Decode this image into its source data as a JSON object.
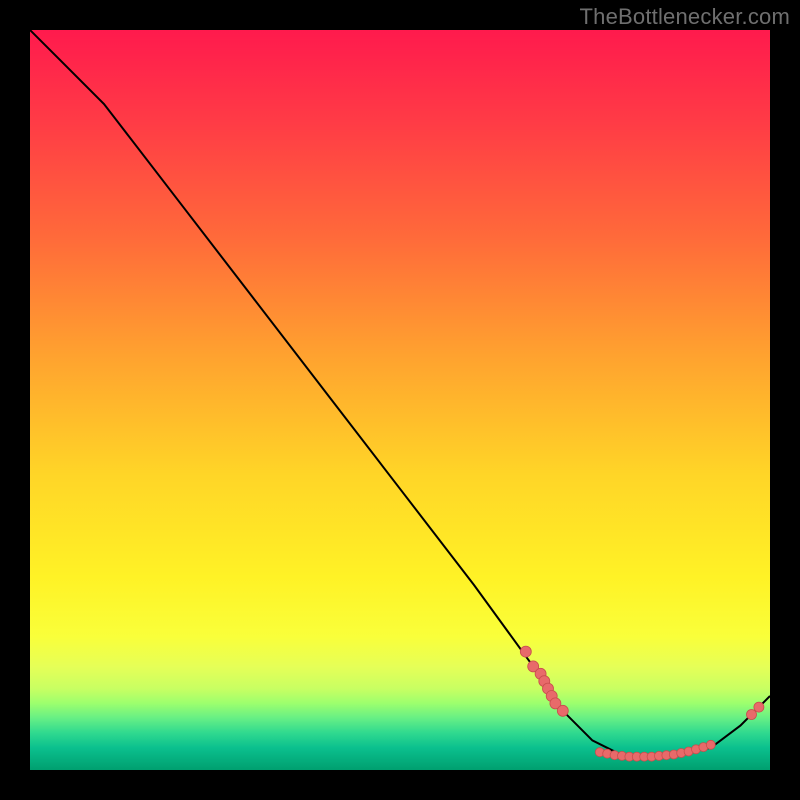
{
  "watermark": "TheBottlenecker.com",
  "chart_data": {
    "type": "line",
    "title": "",
    "xlabel": "",
    "ylabel": "",
    "xlim": [
      0,
      100
    ],
    "ylim": [
      0,
      100
    ],
    "grid": false,
    "legend": false,
    "curve_points": [
      {
        "x": 0,
        "y": 100
      },
      {
        "x": 4,
        "y": 96
      },
      {
        "x": 10,
        "y": 90
      },
      {
        "x": 20,
        "y": 77
      },
      {
        "x": 30,
        "y": 64
      },
      {
        "x": 40,
        "y": 51
      },
      {
        "x": 50,
        "y": 38
      },
      {
        "x": 60,
        "y": 25
      },
      {
        "x": 68,
        "y": 14
      },
      {
        "x": 72,
        "y": 8
      },
      {
        "x": 76,
        "y": 4
      },
      {
        "x": 80,
        "y": 2
      },
      {
        "x": 86,
        "y": 2
      },
      {
        "x": 92,
        "y": 3
      },
      {
        "x": 96,
        "y": 6
      },
      {
        "x": 100,
        "y": 10
      }
    ],
    "markers_left": [
      {
        "x": 67,
        "y": 16
      },
      {
        "x": 68,
        "y": 14
      },
      {
        "x": 69,
        "y": 13
      },
      {
        "x": 69.5,
        "y": 12
      },
      {
        "x": 70,
        "y": 11
      },
      {
        "x": 70.5,
        "y": 10
      },
      {
        "x": 71,
        "y": 9
      },
      {
        "x": 72,
        "y": 8
      }
    ],
    "markers_bottom": [
      {
        "x": 77,
        "y": 2.4
      },
      {
        "x": 78,
        "y": 2.2
      },
      {
        "x": 79,
        "y": 2.0
      },
      {
        "x": 80,
        "y": 1.9
      },
      {
        "x": 81,
        "y": 1.8
      },
      {
        "x": 82,
        "y": 1.8
      },
      {
        "x": 83,
        "y": 1.8
      },
      {
        "x": 84,
        "y": 1.8
      },
      {
        "x": 85,
        "y": 1.9
      },
      {
        "x": 86,
        "y": 2.0
      },
      {
        "x": 87,
        "y": 2.1
      },
      {
        "x": 88,
        "y": 2.3
      },
      {
        "x": 89,
        "y": 2.5
      },
      {
        "x": 90,
        "y": 2.8
      },
      {
        "x": 91,
        "y": 3.1
      },
      {
        "x": 92,
        "y": 3.4
      }
    ],
    "markers_right": [
      {
        "x": 97.5,
        "y": 7.5
      },
      {
        "x": 98.5,
        "y": 8.5
      }
    ],
    "colors": {
      "curve": "#000000",
      "marker_fill": "#e86a6a",
      "marker_stroke": "#c94d4d",
      "background_top": "#ff1a4d",
      "background_bottom": "#009f6f"
    }
  }
}
